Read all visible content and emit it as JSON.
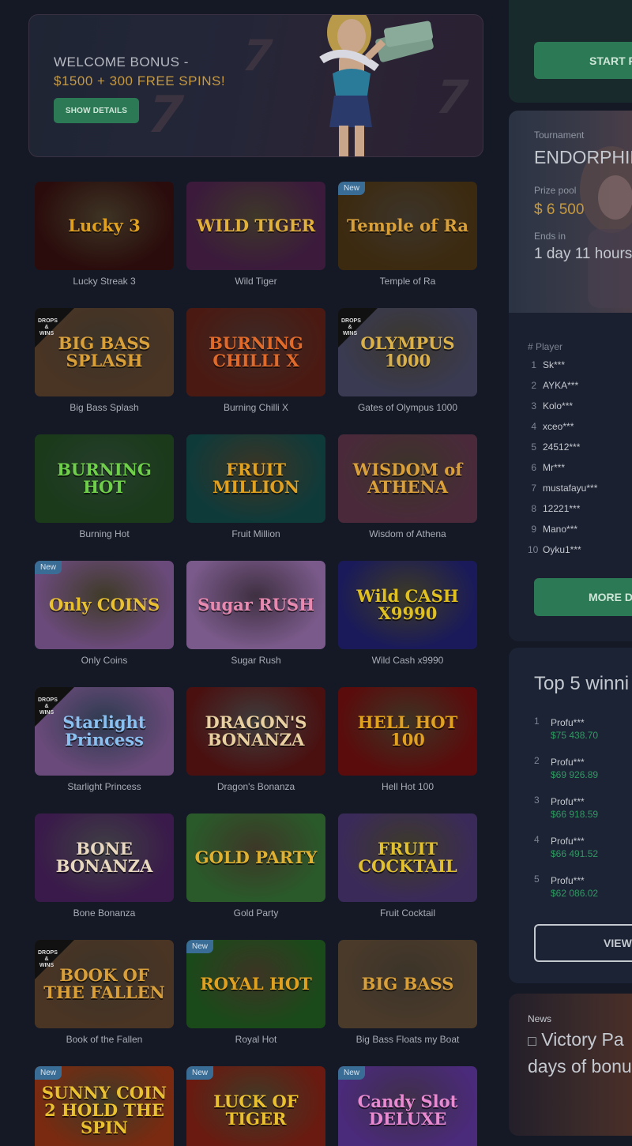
{
  "banner": {
    "line1": "WELCOME BONUS -",
    "line2": "$1500 + 300 FREE SPINS!",
    "button": "SHOW DETAILS"
  },
  "badges": {
    "new": "New",
    "drops": "DROPS & WINS"
  },
  "games": [
    {
      "name": "Lucky Streak 3",
      "art": "Lucky 3",
      "badge": "",
      "bg": "#2a0c0c",
      "fg": "#e0a020"
    },
    {
      "name": "Wild Tiger",
      "art": "WILD TIGER",
      "badge": "",
      "bg": "#3b1a3c",
      "fg": "#e2b13a"
    },
    {
      "name": "Temple of Ra",
      "art": "Temple of Ra",
      "badge": "new",
      "bg": "#3c2a10",
      "fg": "#d9a03a"
    },
    {
      "name": "Big Bass Splash",
      "art": "BIG BASS SPLASH",
      "badge": "drops",
      "bg": "#4a3424",
      "fg": "#d9a03a"
    },
    {
      "name": "Burning Chilli X",
      "art": "BURNING CHILLI X",
      "badge": "",
      "bg": "#4a1a12",
      "fg": "#e06a2a"
    },
    {
      "name": "Gates of Olympus 1000",
      "art": "OLYMPUS 1000",
      "badge": "drops",
      "bg": "#3a3a52",
      "fg": "#d9b04a"
    },
    {
      "name": "Burning Hot",
      "art": "BURNING HOT",
      "badge": "",
      "bg": "#1a3a1a",
      "fg": "#6fcf4a"
    },
    {
      "name": "Fruit Million",
      "art": "FRUIT MILLION",
      "badge": "",
      "bg": "#0f3a3a",
      "fg": "#e0a020"
    },
    {
      "name": "Wisdom of Athena",
      "art": "WISDOM of ATHENA",
      "badge": "",
      "bg": "#4a2a3a",
      "fg": "#d9a03a"
    },
    {
      "name": "Only Coins",
      "art": "Only COINS",
      "badge": "new",
      "bg": "#6a4a7a",
      "fg": "#e8c030"
    },
    {
      "name": "Sugar Rush",
      "art": "Sugar RUSH",
      "badge": "",
      "bg": "#7a5a8a",
      "fg": "#e88ab0"
    },
    {
      "name": "Wild Cash x9990",
      "art": "Wild CASH X9990",
      "badge": "",
      "bg": "#1a1a5a",
      "fg": "#e0c020"
    },
    {
      "name": "Starlight Princess",
      "art": "Starlight Princess",
      "badge": "drops",
      "bg": "#6a4a7a",
      "fg": "#8ac0f0"
    },
    {
      "name": "Dragon's Bonanza",
      "art": "DRAGON'S BONANZA",
      "badge": "",
      "bg": "#4a1010",
      "fg": "#e8d0a0"
    },
    {
      "name": "Hell Hot 100",
      "art": "HELL HOT 100",
      "badge": "",
      "bg": "#5a0c0c",
      "fg": "#e0a020"
    },
    {
      "name": "Bone Bonanza",
      "art": "BONE BONANZA",
      "badge": "",
      "bg": "#3a1a4a",
      "fg": "#e8d8c0"
    },
    {
      "name": "Gold Party",
      "art": "GOLD PARTY",
      "badge": "",
      "bg": "#2a5a2a",
      "fg": "#e0b030"
    },
    {
      "name": "Fruit Cocktail",
      "art": "FRUIT COCKTAIL",
      "badge": "",
      "bg": "#3a2a5a",
      "fg": "#e0c030"
    },
    {
      "name": "Book of the Fallen",
      "art": "BOOK OF THE FALLEN",
      "badge": "drops",
      "bg": "#4a3424",
      "fg": "#d9a03a"
    },
    {
      "name": "Royal Hot",
      "art": "ROYAL HOT",
      "badge": "new",
      "bg": "#1a4a1a",
      "fg": "#e0a020"
    },
    {
      "name": "Big Bass Floats my Boat",
      "art": "BIG BASS",
      "badge": "",
      "bg": "#4a3a2a",
      "fg": "#d9a03a"
    },
    {
      "name": "Sunny Coin 2 Hold The Spin",
      "art": "SUNNY COIN 2 HOLD THE SPIN",
      "badge": "new",
      "bg": "#7a2a10",
      "fg": "#e8c030"
    },
    {
      "name": "Luck of Tiger",
      "art": "LUCK OF TIGER",
      "badge": "new",
      "bg": "#6a1a10",
      "fg": "#e8c030"
    },
    {
      "name": "Candy Slot Deluxe",
      "art": "Candy Slot DELUXE",
      "badge": "new",
      "bg": "#4a2a7a",
      "fg": "#e88ad0"
    }
  ],
  "right": {
    "start_button": "START F",
    "tournament": {
      "label": "Tournament",
      "name": "ENDORPHIN",
      "prize_label": "Prize pool",
      "prize": "$ 6 500",
      "ends_label": "Ends in",
      "ends": "1 day 11 hours"
    },
    "players_header": "# Player",
    "players": [
      {
        "n": "1",
        "name": "Sk***"
      },
      {
        "n": "2",
        "name": "AYKA***"
      },
      {
        "n": "3",
        "name": "Kolo***"
      },
      {
        "n": "4",
        "name": "xceo***"
      },
      {
        "n": "5",
        "name": "24512***"
      },
      {
        "n": "6",
        "name": "Mr***"
      },
      {
        "n": "7",
        "name": "mustafayu***"
      },
      {
        "n": "8",
        "name": "12221***"
      },
      {
        "n": "9",
        "name": "Mano***"
      },
      {
        "n": "10",
        "name": "Oyku1***"
      }
    ],
    "more_button": "MORE D",
    "top5": {
      "title": "Top 5 winni",
      "rows": [
        {
          "n": "1",
          "user": "Profu***",
          "amount": "$75 438.70"
        },
        {
          "n": "2",
          "user": "Profu***",
          "amount": "$69 926.89"
        },
        {
          "n": "3",
          "user": "Profu***",
          "amount": "$66 918.59"
        },
        {
          "n": "4",
          "user": "Profu***",
          "amount": "$66 491.52"
        },
        {
          "n": "5",
          "user": "Profu***",
          "amount": "$62 086.02"
        }
      ],
      "view_button": "VIEW"
    },
    "news": {
      "label": "News",
      "line1": "Victory Pa",
      "line2": "days of bonu"
    }
  }
}
